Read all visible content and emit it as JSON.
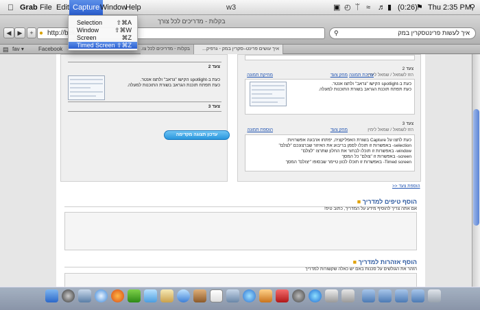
{
  "menubar": {
    "apple": "",
    "app": "Grab",
    "items": [
      "File",
      "Edit",
      "Capture",
      "Window",
      "Help"
    ],
    "battery": "(0:26)",
    "clock": "Thu 2:35 PM",
    "window_title": "w3"
  },
  "capture_menu": [
    {
      "label": "Selection",
      "key": "⇧⌘A"
    },
    {
      "label": "Window",
      "key": "⇧⌘W"
    },
    {
      "label": "Screen",
      "key": "⌘Z"
    },
    {
      "label": "Timed Screen",
      "key": "⇧⌘Z"
    }
  ],
  "browser": {
    "page_title": "בקלות - מדריכים לכל צורך",
    "url": "http://beka",
    "search": "איך לעשות פרינטסקרין במק",
    "add_button": "+",
    "bookmarks": [
      "Facebook",
      "fav ▾"
    ],
    "tabs": [
      "בקלות - מדריכים לכל צו...",
      "איך עושים פרינט–סקרין במק - גרפיק..."
    ]
  },
  "left_col": {
    "step2_label": "צעד 2",
    "step2_line1": "כעת ב-spotlight הקישו \"גראב\" ולחצו אנטר.",
    "step2_line2": "כעת תפתח תוכנת הגראב בשורת התוכנות למעלה.",
    "step3_label": "צעד 3",
    "preview_button": "עדכון תצוגה מקדימה"
  },
  "right_col": {
    "step2_label": "צעד 2",
    "step2_move": "הזז לשמאל / שמאל לימין",
    "step2_links": [
      "מחק צעד",
      "עריכת תמונה",
      "מחיקת תמונה"
    ],
    "step2_line1": "כעת ב-spotlight הקישו \"גראב\" ולחצו אנטר.",
    "step2_line2": "כעת תפתח תוכנת הגראב בשורת התוכנות למעלה.",
    "step3_label": "צעד 3",
    "step3_move": "הזז לשמאל / שמאל לימין",
    "step3_links": [
      "מחק צעד",
      "הוספת תמונה"
    ],
    "step3_lines": [
      "כעת לחצו על Capture בשורת האפליקציה, יפתחו ארבעה אפשרויות:",
      "selection- באפשרות זו תוכלו לסמן בריבוע את האיזור שברצונכם \"לצלם\"",
      "window- באפשרות זו תוכלו לבחור את החלון שתרצו \"לצלם\"",
      "screen- באפשרות זו \"צולם\" כל המסך",
      "Timed screen- באפשרות זו תוכלו לכוון טיימר שבסופו \"יצולם\" המסך"
    ],
    "add_step": ">> הוספת צעד"
  },
  "tips": {
    "title": "הוסף טיפים למדריך",
    "hint": "אם אתה צריך להוסיף מידע על המדריך, כתוב טיפ!"
  },
  "warnings": {
    "title": "הוסף אזהרות למדריך",
    "hint": "הזהר את הגולשים על סכנות באם יש כאלה שקשורות למדריך"
  },
  "colors": {
    "accent": "#2b5fd1",
    "link": "#1a4fb0",
    "button": "#2996dd"
  }
}
